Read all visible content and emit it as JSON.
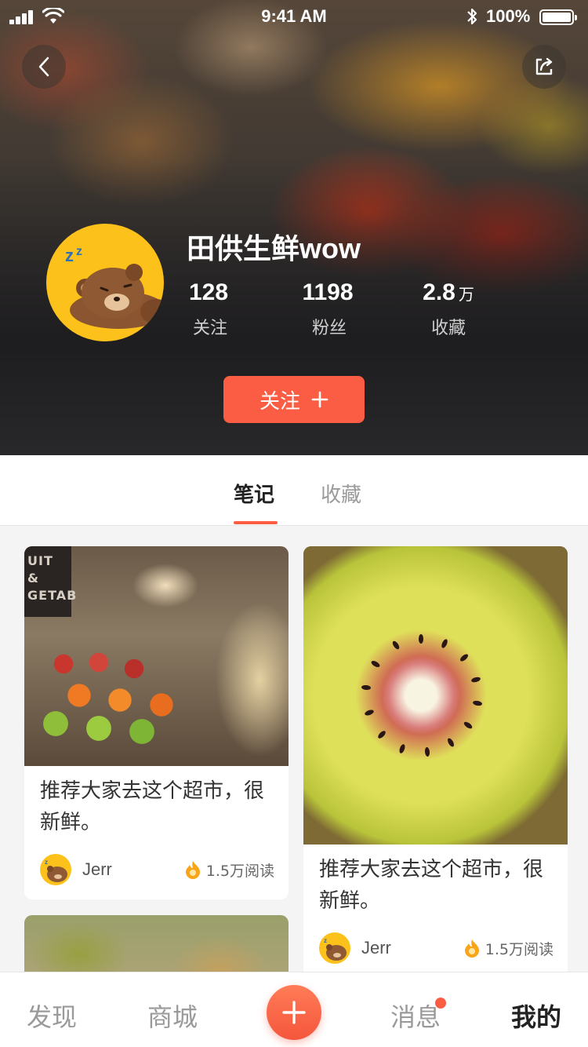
{
  "status_bar": {
    "time": "9:41 AM",
    "battery_percent": "100%",
    "battery_level": 1.0
  },
  "header": {
    "back_icon": "chevron-left-icon",
    "share_icon": "share-icon",
    "profile_name": "田供生鲜wow",
    "avatar": "sleeping-bear-avatar",
    "stats": [
      {
        "value": "128",
        "unit": "",
        "label": "关注"
      },
      {
        "value": "1198",
        "unit": "",
        "label": "粉丝"
      },
      {
        "value": "2.8",
        "unit": "万",
        "label": "收藏"
      }
    ],
    "follow_button": "关注"
  },
  "tabs": [
    {
      "label": "笔记",
      "active": true
    },
    {
      "label": "收藏",
      "active": false
    }
  ],
  "feed": [
    {
      "text": "推荐大家去这个超市，很新鲜。",
      "author": "Jerr",
      "reads": "1.5万阅读",
      "image": "supermarket-produce-photo",
      "sign_text": "UIT & GETAB"
    },
    {
      "text": "推荐大家去这个超市，很新鲜。",
      "author": "Jerr",
      "reads": "1.5万阅读",
      "image": "red-kiwi-cross-section-photo"
    },
    {
      "image": "trees-photo"
    }
  ],
  "bottom_nav": {
    "items": [
      {
        "label": "发现",
        "active": false
      },
      {
        "label": "商城",
        "active": false
      },
      {
        "label": "消息",
        "active": false,
        "badge": true
      },
      {
        "label": "我的",
        "active": true
      }
    ],
    "add_icon": "plus-icon"
  },
  "colors": {
    "accent": "#fa5d43",
    "avatar_bg": "#fcc21b",
    "text_primary": "#222222",
    "text_muted": "#9a9a9a"
  }
}
